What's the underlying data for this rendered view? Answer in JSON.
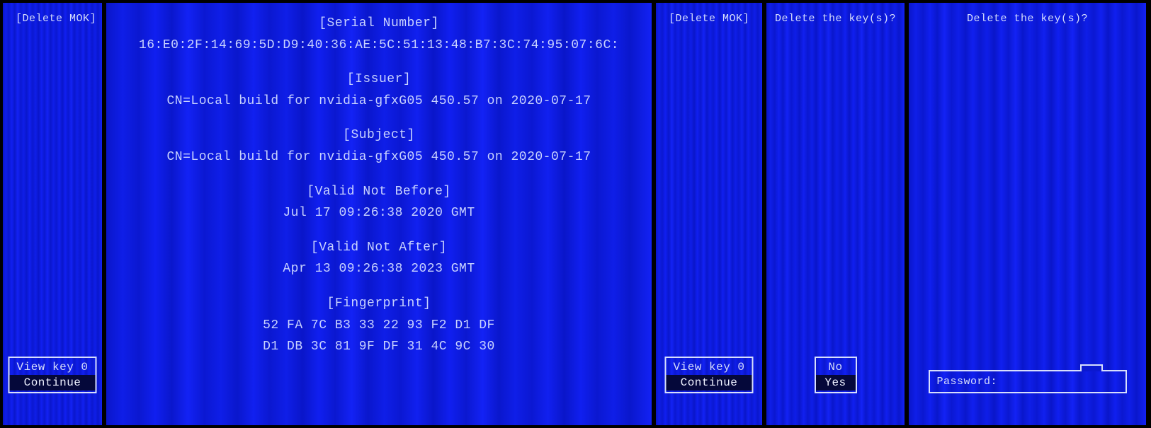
{
  "panel1": {
    "title": "[Delete MOK]",
    "menu": {
      "items": [
        {
          "label": "View key 0",
          "selected": false
        },
        {
          "label": "Continue",
          "selected": true
        }
      ]
    }
  },
  "panel2": {
    "cert": {
      "serial_header": "[Serial Number]",
      "serial_value": "16:E0:2F:14:69:5D:D9:40:36:AE:5C:51:13:48:B7:3C:74:95:07:6C:",
      "issuer_header": "[Issuer]",
      "issuer_value": "CN=Local build for nvidia-gfxG05 450.57 on 2020-07-17",
      "subject_header": "[Subject]",
      "subject_value": "CN=Local build for nvidia-gfxG05 450.57 on 2020-07-17",
      "not_before_header": "[Valid Not Before]",
      "not_before_value": "Jul 17 09:26:38 2020 GMT",
      "not_after_header": "[Valid Not After]",
      "not_after_value": "Apr 13 09:26:38 2023 GMT",
      "fingerprint_header": "[Fingerprint]",
      "fingerprint_line1": "52 FA 7C B3 33 22 93 F2 D1 DF",
      "fingerprint_line2": "D1 DB 3C 81 9F DF 31 4C 9C 30"
    }
  },
  "panel3": {
    "title": "[Delete MOK]",
    "menu": {
      "items": [
        {
          "label": "View key 0",
          "selected": false
        },
        {
          "label": "Continue",
          "selected": true
        }
      ]
    }
  },
  "panel4": {
    "title": "Delete the key(s)?",
    "menu": {
      "items": [
        {
          "label": "No",
          "selected": false
        },
        {
          "label": "Yes",
          "selected": true
        }
      ]
    }
  },
  "panel5": {
    "title": "Delete the key(s)?",
    "password_label": "Password:"
  }
}
